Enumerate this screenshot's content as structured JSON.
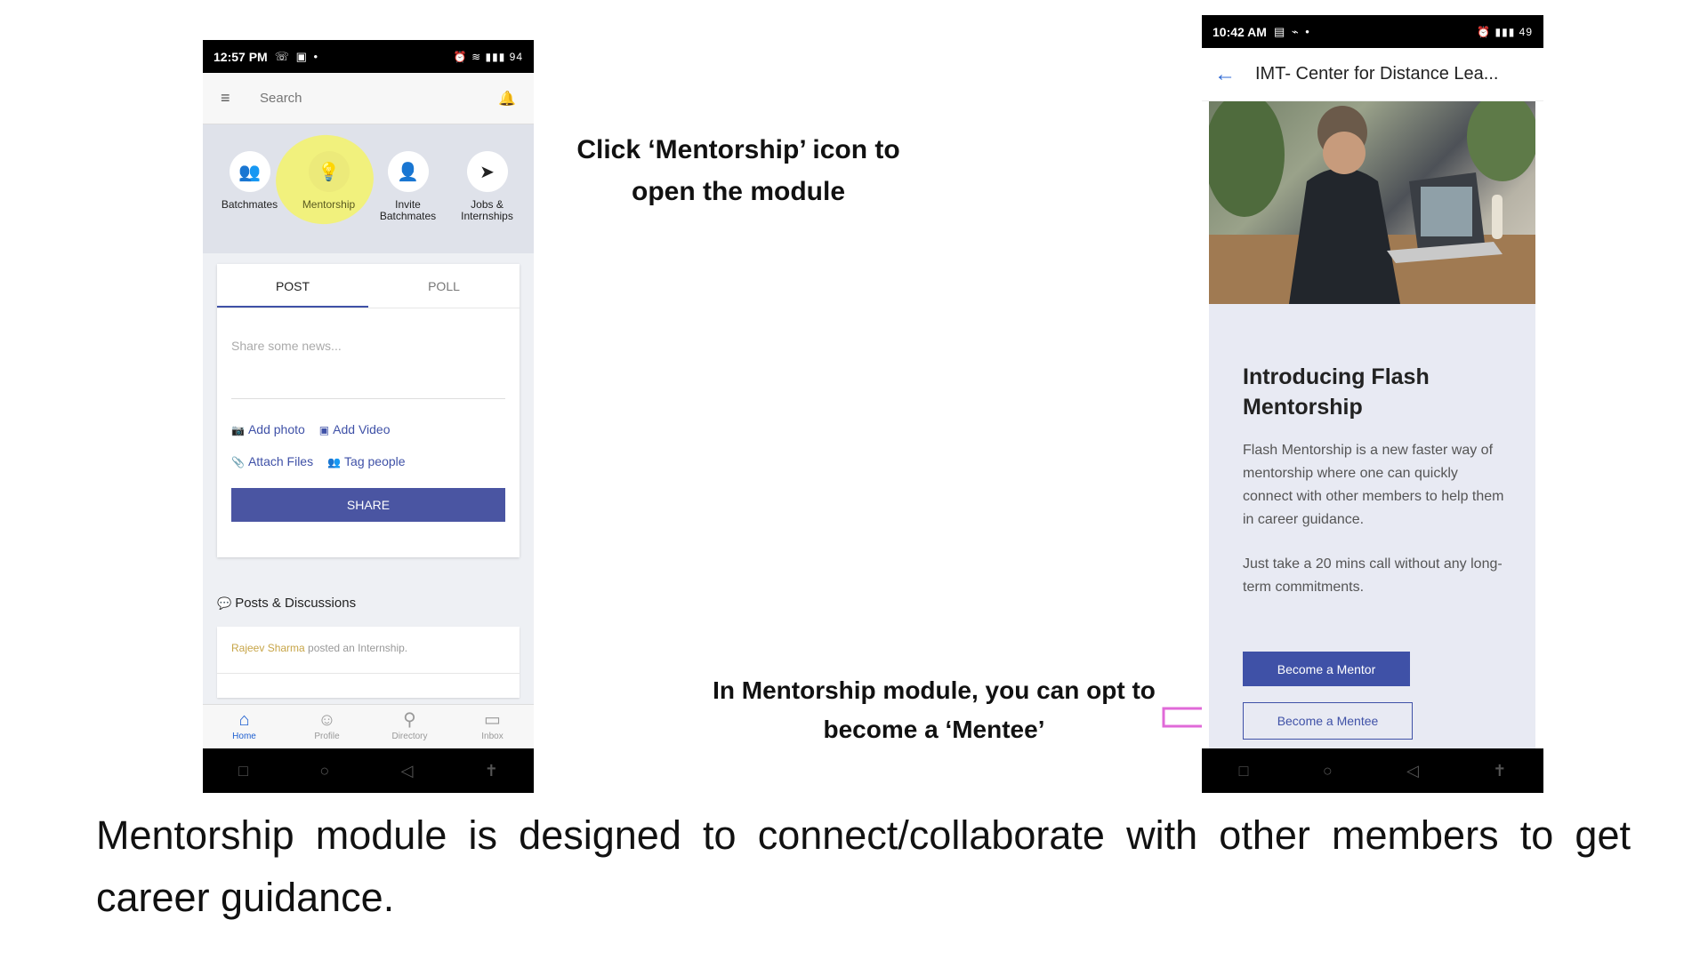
{
  "left_phone": {
    "status": {
      "time": "12:57 PM",
      "icons_left": "☏ ▣ •",
      "icons_right": "⏰ ≋ ▮▮▮ 94"
    },
    "topbar": {
      "menu_icon": "hamburger-icon",
      "search_placeholder": "Search",
      "bell_icon": "bell-icon"
    },
    "quick_actions": [
      {
        "label": "Batchmates",
        "icon": "people-icon"
      },
      {
        "label": "Mentorship",
        "icon": "bulb-icon"
      },
      {
        "label": "Invite Batchmates",
        "icon": "add-person-icon"
      },
      {
        "label": "Jobs & Internships",
        "icon": "paper-plane-icon"
      }
    ],
    "post_card": {
      "tabs": [
        "POST",
        "POLL"
      ],
      "placeholder": "Share some news...",
      "add_photo": "Add photo",
      "add_video": "Add Video",
      "attach_files": "Attach Files",
      "tag_people": "Tag people",
      "share": "SHARE"
    },
    "posts_title": "Posts & Discussions",
    "feed": {
      "author": "Rajeev Sharma",
      "action": " posted an Internship."
    },
    "bottom_nav": [
      {
        "label": "Home",
        "icon": "home-icon"
      },
      {
        "label": "Profile",
        "icon": "profile-icon"
      },
      {
        "label": "Directory",
        "icon": "search-icon"
      },
      {
        "label": "Inbox",
        "icon": "inbox-icon"
      }
    ]
  },
  "right_phone": {
    "status": {
      "time": "10:42 AM",
      "icons_left": "▤ ⌁ •",
      "icons_right": "⏰ ▮▮▮ 49"
    },
    "title": "IMT- Center for Distance Lea...",
    "intro_title": "Introducing Flash Mentorship",
    "intro_p1": "Flash Mentorship is a new faster way of mentorship where one can quickly connect with other members to help them in career guidance.",
    "intro_p2": "Just take a 20 mins call without any long-term commitments.",
    "become_mentor": "Become a Mentor",
    "become_mentee": "Become a Mentee"
  },
  "notes": {
    "note1": "Click ‘Mentorship’ icon to open the module",
    "note2": "In Mentorship module, you can opt to become a ‘Mentee’",
    "caption": "Mentorship module is designed to connect/collaborate with other members to get career guidance."
  },
  "colors": {
    "accent": "#3f51a7",
    "highlight": "#f5f36a",
    "arrow": "#e06ad8"
  }
}
